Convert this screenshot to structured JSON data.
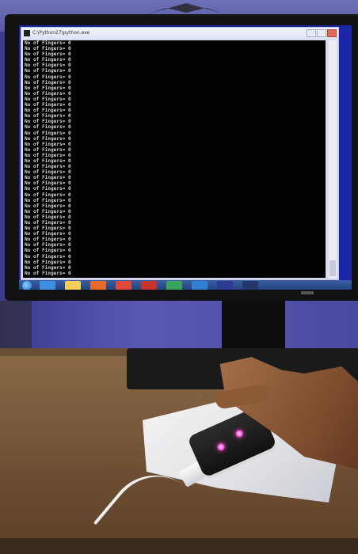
{
  "console": {
    "title": "C:\\Python27\\python.exe",
    "lines": [
      "No of Fingers= 0",
      "No of Fingers= 0",
      "No of Fingers= 0",
      "No of Fingers= 0",
      "No of Fingers= 0",
      "No of Fingers= 0",
      "No of Fingers= 0",
      "No of Fingers= 0",
      "No of Fingers= 0",
      "No of Fingers= 0",
      "No of Fingers= 0",
      "No of Fingers= 0",
      "No of Fingers= 0",
      "No of Fingers= 0",
      "No of Fingers= 0",
      "No of Fingers= 0",
      "No of Fingers= 0",
      "No of Fingers= 0",
      "No of Fingers= 0",
      "No of Fingers= 0",
      "No of Fingers= 0",
      "No of Fingers= 0",
      "No of Fingers= 0",
      "No of Fingers= 0",
      "No of Fingers= 0",
      "No of Fingers= 0",
      "No of Fingers= 0",
      "No of Fingers= 0",
      "No of Fingers= 0",
      "No of Fingers= 0",
      "No of Fingers= 0",
      "No of Fingers= 0",
      "No of Fingers= 0",
      "No of Fingers= 0",
      "No of Fingers= 0",
      "No of Fingers= 0",
      "No of Fingers= 0",
      "No of Fingers= 0",
      "No of Fingers= 0",
      "No of Fingers= 0",
      "No of Fingers= 0",
      "No of Fingers= 0"
    ]
  },
  "taskbar": {
    "icons": [
      "start-orb-icon",
      "ie-icon",
      "folder-icon",
      "media-player-icon",
      "chrome-icon",
      "red-app-icon",
      "green-app-icon",
      "blue-app-icon",
      "python-icon",
      "console-icon"
    ],
    "colors": [
      "#1b6fcf",
      "#3e8fe0",
      "#f4cf5a",
      "#e56a2b",
      "#e04a3a",
      "#c6342b",
      "#3aa35b",
      "#2f7fd2",
      "#2d3a8f",
      "#26356a"
    ]
  },
  "colors": {
    "wall": "#4a4d9a",
    "desk": "#7a5a3c",
    "led": "#ff4fd0"
  }
}
